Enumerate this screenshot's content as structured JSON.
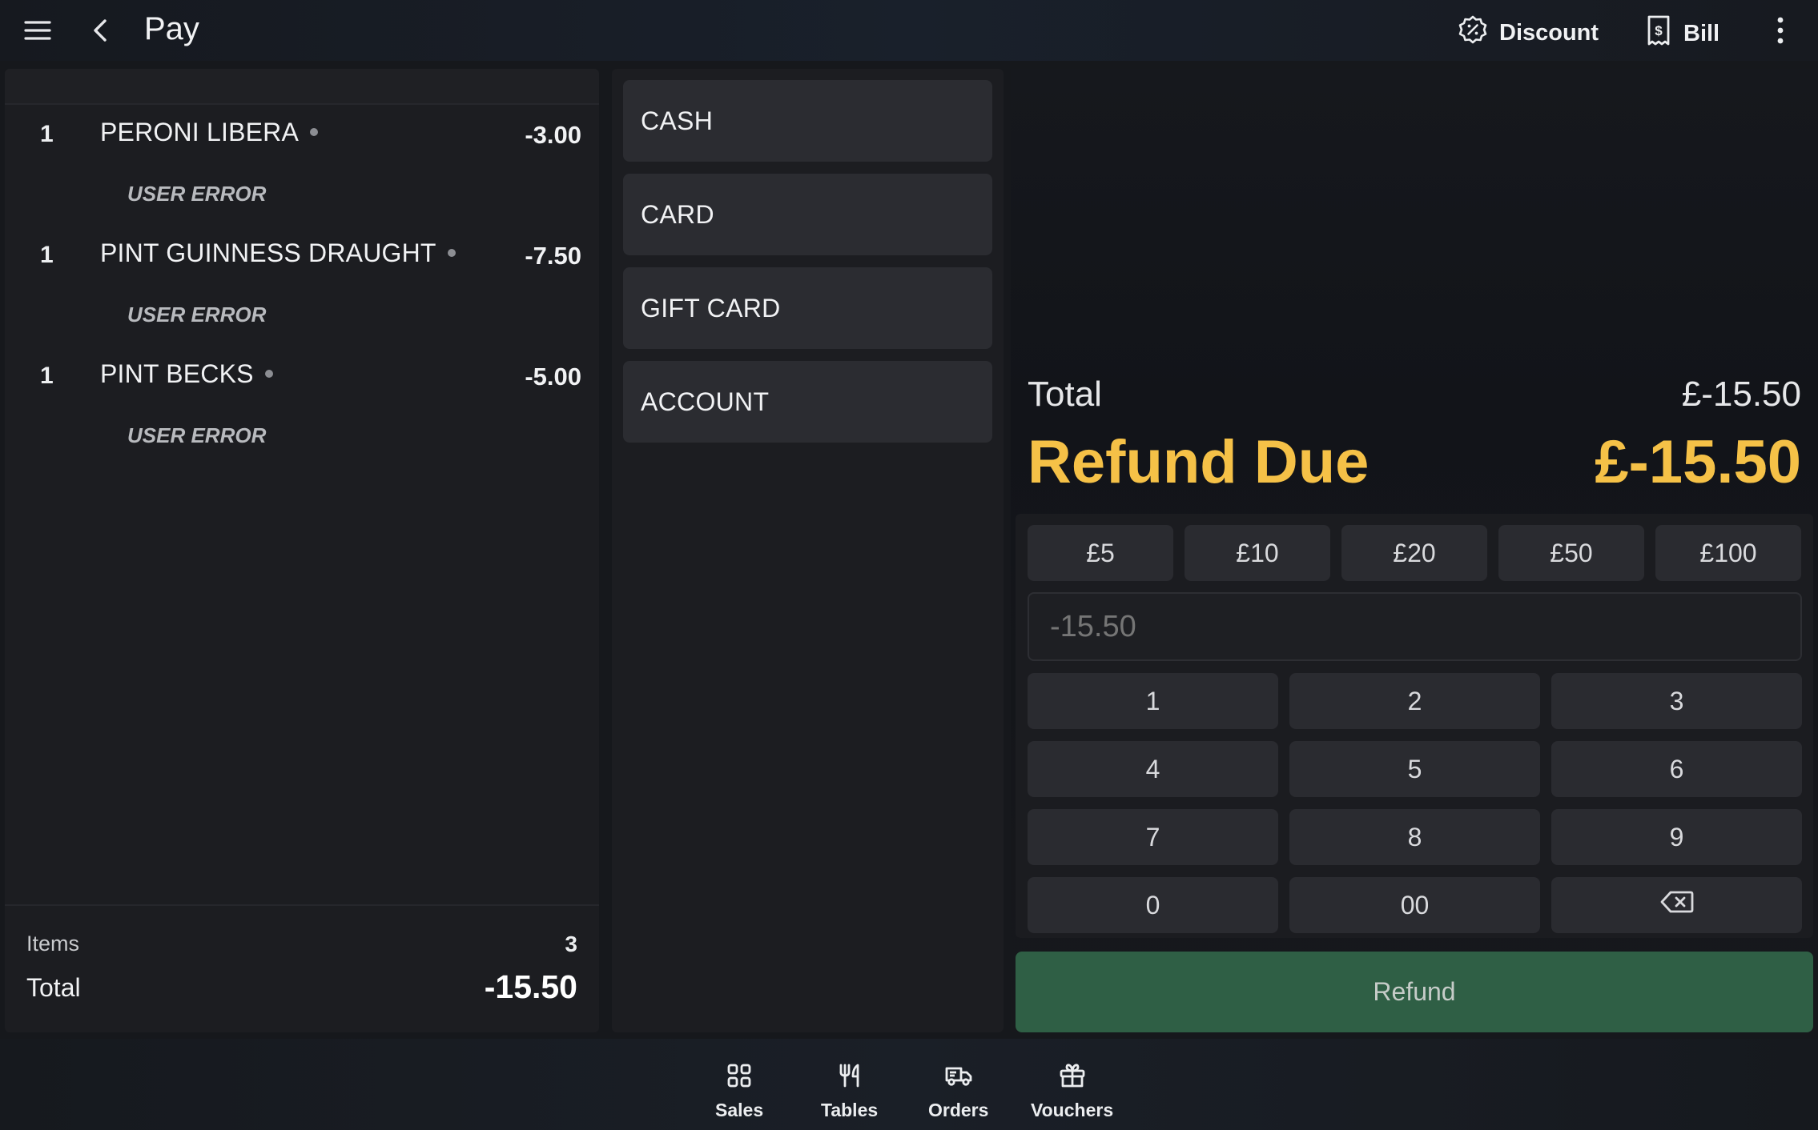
{
  "header": {
    "title": "Pay",
    "discount_label": "Discount",
    "bill_label": "Bill"
  },
  "order": {
    "items": [
      {
        "qty": "1",
        "name": "PERONI LIBERA",
        "price": "-3.00",
        "note": "USER ERROR"
      },
      {
        "qty": "1",
        "name": "PINT GUINNESS DRAUGHT",
        "price": "-7.50",
        "note": "USER ERROR"
      },
      {
        "qty": "1",
        "name": "PINT BECKS",
        "price": "-5.00",
        "note": "USER ERROR"
      }
    ],
    "items_label": "Items",
    "items_count": "3",
    "total_label": "Total",
    "total_value": "-15.50"
  },
  "payment_methods": [
    "CASH",
    "CARD",
    "GIFT CARD",
    "ACCOUNT"
  ],
  "summary": {
    "total_label": "Total",
    "total_value": "£-15.50",
    "refund_label": "Refund Due",
    "refund_value": "£-15.50"
  },
  "keypad": {
    "quick_amounts": [
      "£5",
      "£10",
      "£20",
      "£50",
      "£100"
    ],
    "input_placeholder": "-15.50",
    "keys": [
      "1",
      "2",
      "3",
      "4",
      "5",
      "6",
      "7",
      "8",
      "9",
      "0",
      "00"
    ],
    "backspace_icon": "backspace-icon"
  },
  "refund_button_label": "Refund",
  "nav": {
    "items": [
      {
        "label": "Sales",
        "icon": "grid-icon"
      },
      {
        "label": "Tables",
        "icon": "cutlery-icon"
      },
      {
        "label": "Orders",
        "icon": "delivery-truck-icon"
      },
      {
        "label": "Vouchers",
        "icon": "gift-icon"
      }
    ]
  },
  "colors": {
    "accent_refund": "#f5c147",
    "refund_button": "#2f5f45",
    "background": "#16181c"
  }
}
